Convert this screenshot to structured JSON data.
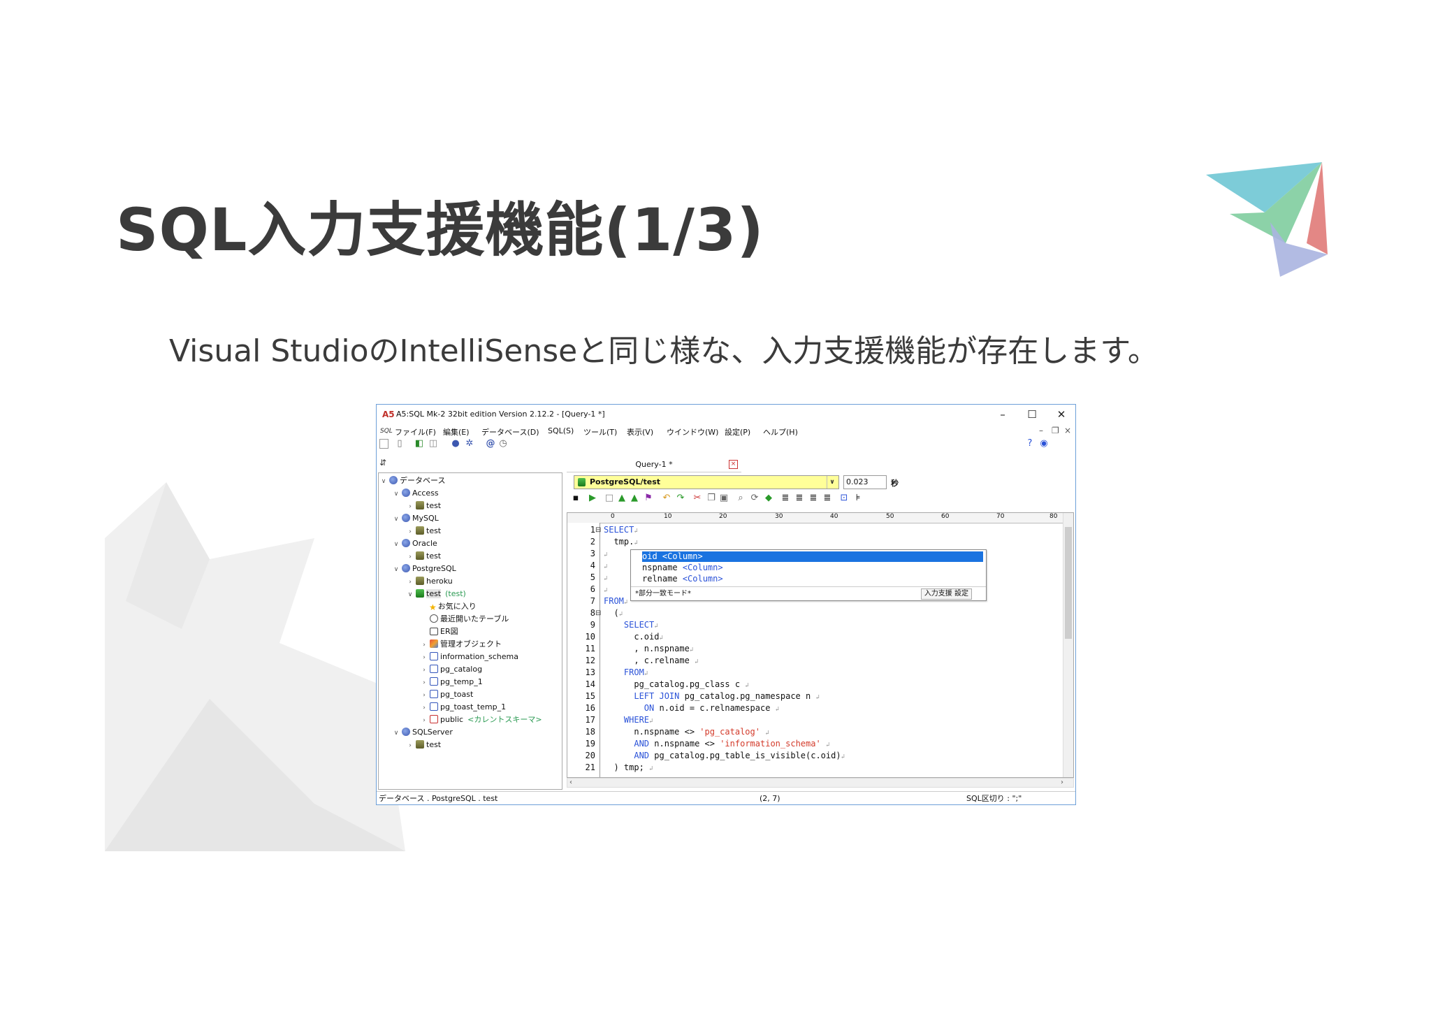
{
  "slide": {
    "title": "SQL入力支援機能(1/3)",
    "subtitle": "Visual StudioのIntelliSenseと同じ様な、入力支援機能が存在します。"
  },
  "window": {
    "title": "A5:SQL Mk-2 32bit edition Version 2.12.2 - [Query-1 *]",
    "controls": {
      "minimize": "–",
      "maximize": "☐",
      "close": "✕"
    }
  },
  "menu": {
    "sql_tag": "SQL",
    "items": [
      "ファイル(F)",
      "編集(E)",
      "データベース(D)",
      "SQL(S)",
      "ツール(T)",
      "表示(V)",
      "ウインドウ(W)",
      "設定(P)",
      "ヘルプ(H)"
    ]
  },
  "tree": {
    "root": "データベース",
    "nodes": [
      {
        "label": "Access",
        "child": "test"
      },
      {
        "label": "MySQL",
        "child": "test"
      },
      {
        "label": "Oracle",
        "child": "test"
      },
      {
        "label": "PostgreSQL",
        "children": [
          "heroku",
          "test"
        ],
        "active_note": "(test)"
      }
    ],
    "postgres_test_items": [
      "お気に入り",
      "最近開いたテーブル",
      "ER図",
      "管理オブジェクト",
      "information_schema",
      "pg_catalog",
      "pg_temp_1",
      "pg_toast",
      "pg_toast_temp_1",
      "public"
    ],
    "public_note": "<カレントスキーマ>",
    "sqlserver": {
      "label": "SQLServer",
      "child": "test"
    }
  },
  "query": {
    "tab_label": "Query-1 *",
    "connection": "PostgreSQL/test",
    "elapsed": "0.023",
    "elapsed_unit": "秒",
    "ruler": [
      "0",
      "10",
      "20",
      "30",
      "40",
      "50",
      "60",
      "70",
      "80"
    ]
  },
  "intellisense": {
    "items": [
      {
        "name": "oid",
        "type": "<Column>"
      },
      {
        "name": "nspname",
        "type": "<Column>"
      },
      {
        "name": "relname",
        "type": "<Column>"
      }
    ],
    "mode": "*部分一致モード*",
    "settings_label": "入力支援 設定"
  },
  "status": {
    "path": "データベース . PostgreSQL . test",
    "cursor": "(2, 7)",
    "sql_delimiter": "SQL区切り : \";\""
  },
  "colors": {
    "accent": "#1a73e0",
    "keyword": "#2a52d8",
    "string": "#d33a2a",
    "connection_bg": "#ffff99",
    "current_schema_note": "#2a9a52"
  }
}
